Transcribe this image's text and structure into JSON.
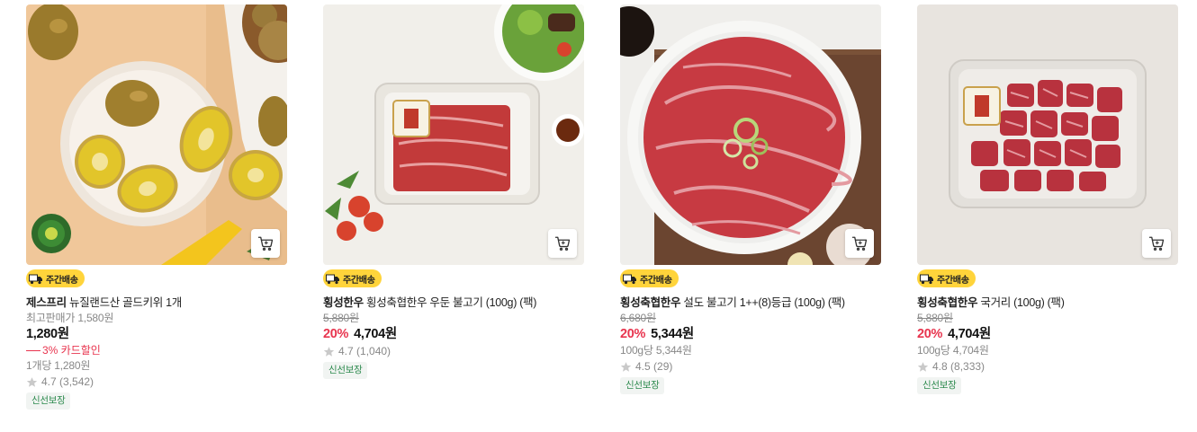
{
  "products": [
    {
      "brand": "제스프리",
      "name": "뉴질랜드산 골드키위 1개",
      "delivery_badge": "주간배송",
      "list_price_label": "최고판매가 1,580원",
      "price": "1,280원",
      "card_discount": "3% 카드할인",
      "unit_price": "1개당 1,280원",
      "rating": "4.7",
      "review_count": "(3,542)",
      "tag": "신선보장"
    },
    {
      "brand": "횡성한우",
      "name": "횡성축협한우 우둔 불고기 (100g) (팩)",
      "delivery_badge": "주간배송",
      "original_price": "5,880원",
      "discount_pct": "20%",
      "price": "4,704원",
      "rating": "4.7",
      "review_count": "(1,040)",
      "tag": "신선보장"
    },
    {
      "brand": "횡성축협한우",
      "name": "설도 불고기 1++(8)등급 (100g) (팩)",
      "delivery_badge": "주간배송",
      "original_price": "6,680원",
      "discount_pct": "20%",
      "price": "5,344원",
      "unit_price": "100g당 5,344원",
      "rating": "4.5",
      "review_count": "(29)",
      "tag": "신선보장"
    },
    {
      "brand": "횡성축협한우",
      "name": "국거리 (100g) (팩)",
      "delivery_badge": "주간배송",
      "original_price": "5,880원",
      "discount_pct": "20%",
      "price": "4,704원",
      "unit_price": "100g당 4,704원",
      "rating": "4.8",
      "review_count": "(8,333)",
      "tag": "신선보장"
    }
  ],
  "icons": {
    "cart": "cart-icon",
    "truck": "truck-icon",
    "star": "star-icon"
  },
  "colors": {
    "discount": "#e8344e",
    "badge_bg": "#ffd43b",
    "fresh_tag": "#2e8b4f",
    "muted_text": "#888888"
  }
}
